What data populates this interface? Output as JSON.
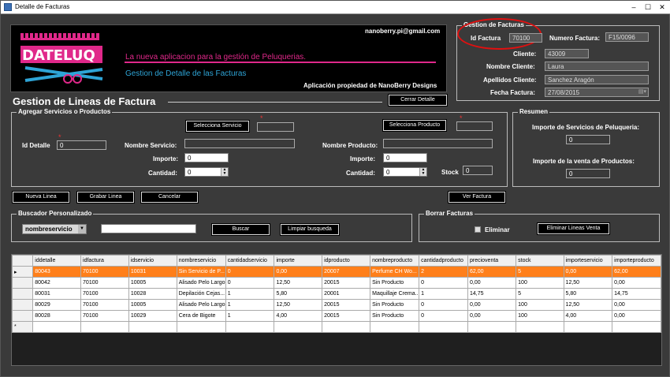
{
  "window": {
    "title": "Detalle de Facturas",
    "minimize": "–",
    "maximize": "☐",
    "close": "✕"
  },
  "banner": {
    "email": "nanoberry.pi@gmail.com",
    "logo_text": "DATELUQ",
    "tagline": "La nueva aplicacion para la gestión de Peluquerias.",
    "subtitle": "Gestion de Detalle de las Facturas",
    "owner": "Aplicación propiedad de NanoBerry Designs"
  },
  "gestion": {
    "title": "Gestion de Facturas",
    "id_factura_label": "Id Factura",
    "id_factura": "70100",
    "numero_label": "Numero Factura:",
    "numero": "F15/0096",
    "cliente_label": "Cliente:",
    "cliente": "43009",
    "nombre_label": "Nombre Cliente:",
    "nombre": "Laura",
    "apellidos_label": "Apellidos Cliente:",
    "apellidos": "Sanchez Aragón",
    "fecha_label": "Fecha Factura:",
    "fecha": "27/08/2015"
  },
  "lineas": {
    "title": "Gestion de Lineas de Factura",
    "cerrar": "Cerrar Detalle"
  },
  "agregar": {
    "title": "Agregar Servicios o Productos",
    "sel_servicio": "Selecciona Servicio",
    "sel_producto": "Selecciona Producto",
    "id_detalle_label": "Id Detalle",
    "id_detalle": "0",
    "nombre_servicio_label": "Nombre Servicio:",
    "nombre_producto_label": "Nombre Producto:",
    "importe_label": "Importe:",
    "importe_s": "0",
    "importe_p": "0",
    "cantidad_label": "Cantidad:",
    "cantidad_s": "0",
    "cantidad_p": "0",
    "stock_label": "Stock",
    "stock": "0",
    "star": "*"
  },
  "resumen": {
    "title": "Resumen",
    "servicios_label": "Importe de Servicios de Peluqueria:",
    "servicios": "0",
    "productos_label": "Importe de la venta de Productos:",
    "productos": "0"
  },
  "actions": {
    "nueva": "Nueva Linea",
    "grabar": "Grabar Linea",
    "cancelar": "Cancelar",
    "ver": "Ver Factura"
  },
  "buscador": {
    "title": "Buscador Personalizado",
    "select": "nombreservicio",
    "query": "",
    "buscar": "Buscar",
    "limpiar": "Limpiar busqueda"
  },
  "borrar": {
    "title": "Borrar Facturas",
    "eliminar": "Eliminar",
    "eliminar_btn": "Eliminar Lineas Venta"
  },
  "table": {
    "columns": [
      "iddetalle",
      "idfactura",
      "idservicio",
      "nombreservicio",
      "cantidadservicio",
      "importe",
      "idproducto",
      "nombreproducto",
      "cantidadproducto",
      "precioventa",
      "stock",
      "importeservicio",
      "importeproducto"
    ],
    "rows": [
      [
        "80043",
        "70100",
        "10031",
        "Sin Servicio de P...",
        "0",
        "0,00",
        "20007",
        "Perfume CH Wo...",
        "2",
        "62,00",
        "5",
        "0,00",
        "62,00"
      ],
      [
        "80042",
        "70100",
        "10005",
        "Alisado Pelo Largo",
        "0",
        "12,50",
        "20015",
        "Sin Producto",
        "0",
        "0,00",
        "100",
        "12,50",
        "0,00"
      ],
      [
        "80031",
        "70100",
        "10028",
        "Depilación Cejas...",
        "1",
        "5,80",
        "20001",
        "Maquillaje Crema...",
        "1",
        "14,75",
        "5",
        "5,80",
        "14,75"
      ],
      [
        "80029",
        "70100",
        "10005",
        "Alisado Pelo Largo",
        "1",
        "12,50",
        "20015",
        "Sin Producto",
        "0",
        "0,00",
        "100",
        "12,50",
        "0,00"
      ],
      [
        "80028",
        "70100",
        "10029",
        "Cera de Bigote",
        "1",
        "4,00",
        "20015",
        "Sin Producto",
        "0",
        "0,00",
        "100",
        "4,00",
        "0,00"
      ]
    ],
    "selected_row": 0,
    "current_marker": "▸",
    "new_row_marker": "*"
  },
  "colors": {
    "accent": "#ff7f1a",
    "highlight_circle": "#e01010",
    "logo_pink": "#e0288a",
    "logo_blue": "#2ea4d6"
  }
}
